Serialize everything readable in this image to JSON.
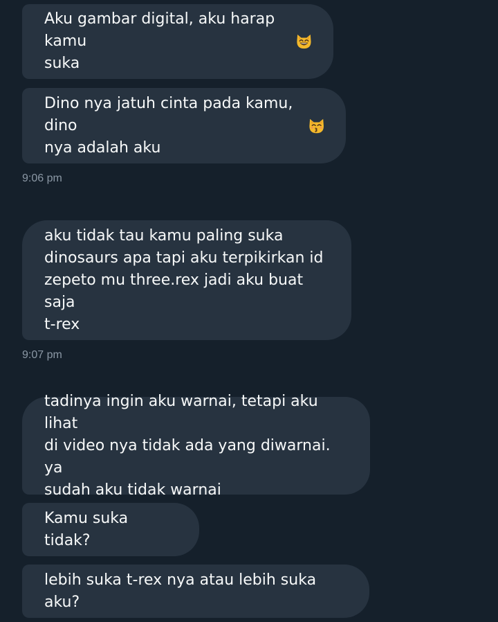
{
  "messages": [
    {
      "text": "Aku gambar digital, aku harap kamu\nsuka",
      "emoji": "grinning-cat-icon"
    },
    {
      "text": "Dino nya jatuh cinta pada kamu, dino\nnya adalah aku",
      "emoji": "kissing-cat-icon"
    },
    {
      "text": "aku tidak tau kamu paling suka\ndinosaurs apa tapi aku terpikirkan id\nzepeto mu three.rex jadi aku buat saja\nt-rex"
    },
    {
      "text": "tadinya ingin aku warnai, tetapi aku lihat\ndi video nya tidak ada yang diwarnai. ya\nsudah aku tidak warnai"
    },
    {
      "text": "Kamu suka tidak?"
    },
    {
      "text": "lebih suka t-rex nya atau lebih suka aku?"
    }
  ],
  "timestamps": [
    "9:06 pm",
    "9:07 pm"
  ],
  "colors": {
    "background": "#15202b",
    "bubble": "#273340",
    "text": "#f7f9f9",
    "timestamp": "#8b98a5"
  }
}
